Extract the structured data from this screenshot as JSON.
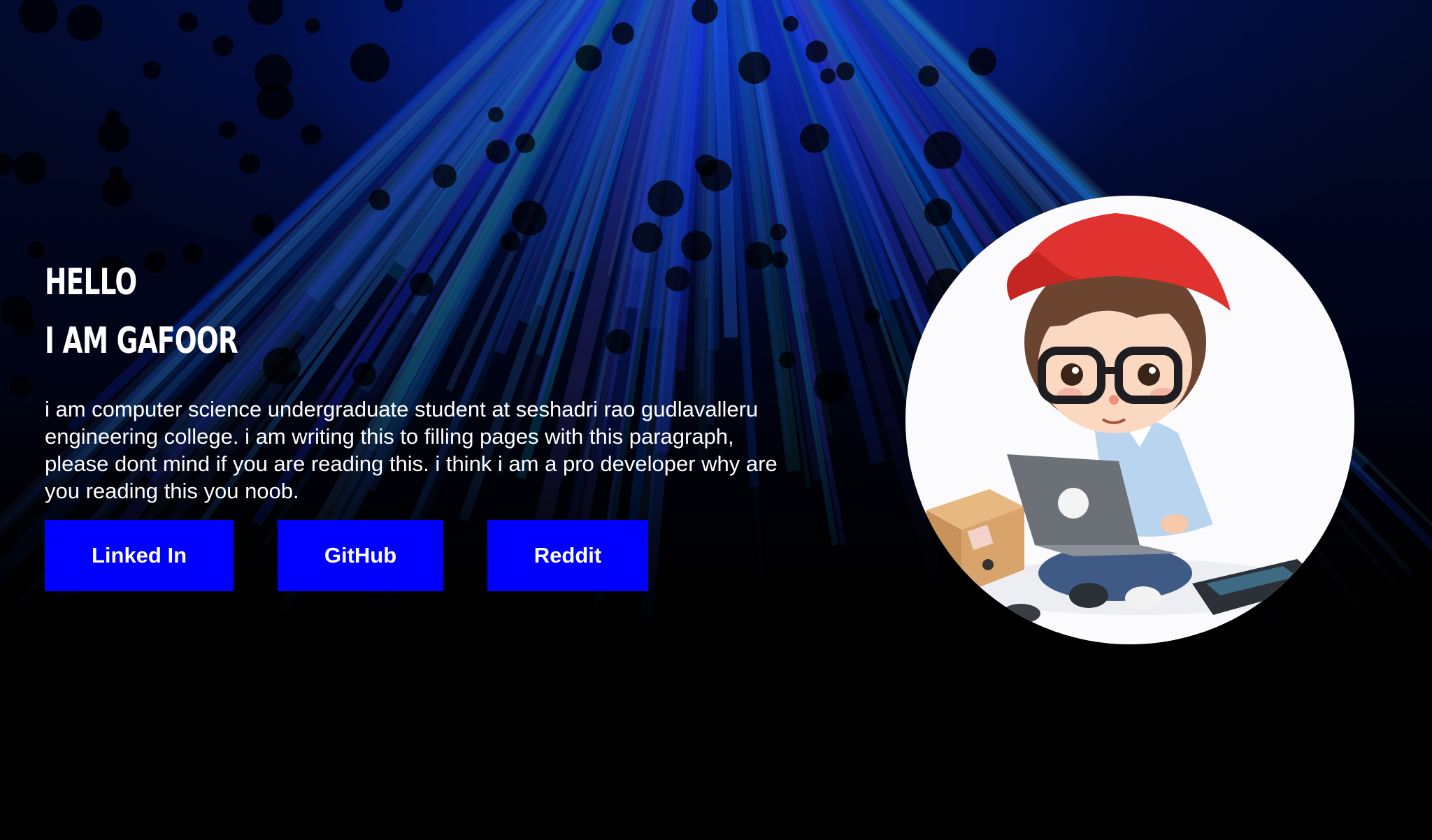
{
  "hero": {
    "greeting": "HELLO",
    "name_line": "I AM GAFOOR",
    "bio": "i am computer science undergraduate student at seshadri rao gudlavalleru engineering college. i am writing this to filling pages with this paragraph, please dont mind if you are reading this. i think i am a pro developer why are you reading this you noob."
  },
  "buttons": {
    "linkedin": "Linked In",
    "github": "GitHub",
    "reddit": "Reddit"
  },
  "colors": {
    "button_bg": "#0000ff",
    "text": "#ffffff",
    "page_bg": "#000000"
  }
}
